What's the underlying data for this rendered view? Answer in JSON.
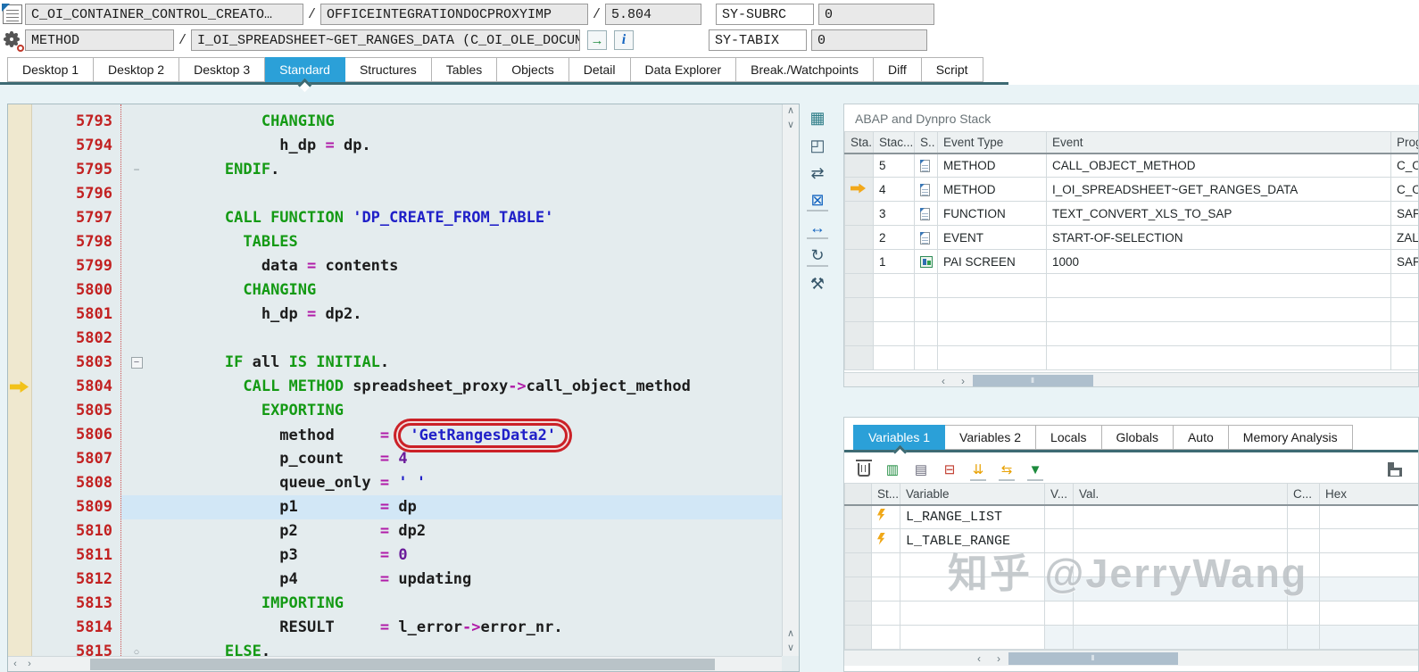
{
  "header": {
    "row1": {
      "source_icon": "abap-source-icon",
      "class_field": "C_OI_CONTAINER_CONTROL_CREATO…",
      "sep1": "/",
      "program_field": "OFFICEINTEGRATIONDOCPROXYIMP",
      "sep2": "/",
      "line_field": "5.804",
      "sysvar_label": "SY-SUBRC",
      "sysvar_value": "0"
    },
    "row2": {
      "method_icon": "method-gear-icon",
      "kind_field": "METHOD",
      "sep1": "/",
      "method_field": "I_OI_SPREADSHEET~GET_RANGES_DATA (C_OI_OLE_DOCUMEN…",
      "buttons": [
        "goto-icon",
        "info-icon"
      ],
      "sysvar_label": "SY-TABIX",
      "sysvar_value": "0"
    }
  },
  "tabs": {
    "items": [
      "Desktop 1",
      "Desktop 2",
      "Desktop 3",
      "Standard",
      "Structures",
      "Tables",
      "Objects",
      "Detail",
      "Data Explorer",
      "Break./Watchpoints",
      "Diff",
      "Script"
    ],
    "active": "Standard"
  },
  "editor": {
    "current_line": 5804,
    "highlighted_line": 5809,
    "annotation": "red-oval-around-GetRangesData2",
    "lines": [
      {
        "num": 5793,
        "segs": [
          [
            "pl",
            "            "
          ],
          [
            "kw",
            "CHANGING"
          ]
        ]
      },
      {
        "num": 5794,
        "segs": [
          [
            "pl",
            "              h_dp "
          ],
          [
            "op",
            "="
          ],
          [
            "pl",
            " dp."
          ]
        ]
      },
      {
        "num": 5795,
        "fold": "dash",
        "segs": [
          [
            "pl",
            "        "
          ],
          [
            "kw",
            "ENDIF"
          ],
          [
            "pl",
            "."
          ]
        ]
      },
      {
        "num": 5796,
        "segs": []
      },
      {
        "num": 5797,
        "segs": [
          [
            "pl",
            "        "
          ],
          [
            "kw",
            "CALL FUNCTION"
          ],
          [
            "pl",
            " "
          ],
          [
            "str",
            "'DP_CREATE_FROM_TABLE'"
          ]
        ]
      },
      {
        "num": 5798,
        "segs": [
          [
            "pl",
            "          "
          ],
          [
            "kw",
            "TABLES"
          ]
        ]
      },
      {
        "num": 5799,
        "segs": [
          [
            "pl",
            "            data "
          ],
          [
            "op",
            "="
          ],
          [
            "pl",
            " contents"
          ]
        ]
      },
      {
        "num": 5800,
        "segs": [
          [
            "pl",
            "          "
          ],
          [
            "kw",
            "CHANGING"
          ]
        ]
      },
      {
        "num": 5801,
        "segs": [
          [
            "pl",
            "            h_dp "
          ],
          [
            "op",
            "="
          ],
          [
            "pl",
            " dp2."
          ]
        ]
      },
      {
        "num": 5802,
        "segs": []
      },
      {
        "num": 5803,
        "fold": "minus",
        "segs": [
          [
            "pl",
            "        "
          ],
          [
            "kw",
            "IF"
          ],
          [
            "pl",
            " all "
          ],
          [
            "kw",
            "IS INITIAL"
          ],
          [
            "pl",
            "."
          ]
        ]
      },
      {
        "num": 5804,
        "arrow": true,
        "segs": [
          [
            "pl",
            "          "
          ],
          [
            "kw",
            "CALL METHOD"
          ],
          [
            "pl",
            " spreadsheet_proxy"
          ],
          [
            "op",
            "->"
          ],
          [
            "pl",
            "call_object_method"
          ]
        ]
      },
      {
        "num": 5805,
        "segs": [
          [
            "pl",
            "            "
          ],
          [
            "kw",
            "EXPORTING"
          ]
        ]
      },
      {
        "num": 5806,
        "segs": [
          [
            "pl",
            "              method     "
          ],
          [
            "op",
            "="
          ],
          [
            "pl",
            " "
          ],
          [
            "annot",
            "'GetRangesData2'"
          ]
        ]
      },
      {
        "num": 5807,
        "segs": [
          [
            "pl",
            "              p_count    "
          ],
          [
            "op",
            "="
          ],
          [
            "pl",
            " "
          ],
          [
            "num",
            "4"
          ]
        ]
      },
      {
        "num": 5808,
        "segs": [
          [
            "pl",
            "              queue_only "
          ],
          [
            "op",
            "="
          ],
          [
            "pl",
            " "
          ],
          [
            "str",
            "' '"
          ]
        ]
      },
      {
        "num": 5809,
        "hl": true,
        "segs": [
          [
            "pl",
            "              p1         "
          ],
          [
            "op",
            "="
          ],
          [
            "pl",
            " dp"
          ]
        ]
      },
      {
        "num": 5810,
        "segs": [
          [
            "pl",
            "              p2         "
          ],
          [
            "op",
            "="
          ],
          [
            "pl",
            " dp2"
          ]
        ]
      },
      {
        "num": 5811,
        "segs": [
          [
            "pl",
            "              p3         "
          ],
          [
            "op",
            "="
          ],
          [
            "pl",
            " "
          ],
          [
            "num",
            "0"
          ]
        ]
      },
      {
        "num": 5812,
        "segs": [
          [
            "pl",
            "              p4         "
          ],
          [
            "op",
            "="
          ],
          [
            "pl",
            " updating"
          ]
        ]
      },
      {
        "num": 5813,
        "segs": [
          [
            "pl",
            "            "
          ],
          [
            "kw",
            "IMPORTING"
          ]
        ]
      },
      {
        "num": 5814,
        "segs": [
          [
            "pl",
            "              RESULT     "
          ],
          [
            "op",
            "="
          ],
          [
            "pl",
            " l_error"
          ],
          [
            "op",
            "->"
          ],
          [
            "pl",
            "error_nr."
          ]
        ]
      },
      {
        "num": 5815,
        "fold": "circle",
        "segs": [
          [
            "pl",
            "        "
          ],
          [
            "kw",
            "ELSE"
          ],
          [
            "pl",
            "."
          ]
        ]
      }
    ]
  },
  "side_toolbar": {
    "icons": [
      {
        "name": "session-grid-icon",
        "glyph": "▦",
        "tone": "teal"
      },
      {
        "name": "new-session-icon",
        "glyph": "◰",
        "tone": ""
      },
      {
        "name": "swap-views-icon",
        "glyph": "⇄",
        "tone": ""
      },
      {
        "name": "close-table-icon",
        "glyph": "⊠",
        "tone": "blue"
      },
      {
        "name": "column-width-icon",
        "glyph": "↔",
        "tone": "blue"
      },
      {
        "name": "refresh-icon",
        "glyph": "↻",
        "tone": ""
      },
      {
        "name": "tools-icon",
        "glyph": "⚒",
        "tone": ""
      }
    ]
  },
  "stack_panel": {
    "title": "ABAP and Dynpro Stack",
    "columns": [
      "Sta...",
      "Stac...",
      "S..",
      "Event Type",
      "Event",
      "Program"
    ],
    "rows": [
      {
        "arrow": false,
        "num": "5",
        "icon": "doc-icon",
        "type": "METHOD",
        "event": "CALL_OBJECT_METHOD",
        "program": "C_OI_A"
      },
      {
        "arrow": true,
        "num": "4",
        "icon": "doc-icon",
        "type": "METHOD",
        "event": "I_OI_SPREADSHEET~GET_RANGES_DATA",
        "program": "C_OI_C"
      },
      {
        "arrow": false,
        "num": "3",
        "icon": "doc-icon",
        "type": "FUNCTION",
        "event": "TEXT_CONVERT_XLS_TO_SAP",
        "program": "SAPLTR"
      },
      {
        "arrow": false,
        "num": "2",
        "icon": "doc-icon",
        "type": "EVENT",
        "event": "START-OF-SELECTION",
        "program": "ZALV_JE"
      },
      {
        "arrow": false,
        "num": "1",
        "icon": "screen-icon",
        "type": "PAI SCREEN",
        "event": "1000",
        "program": "SAPMSS"
      }
    ],
    "empty_rows": 4,
    "scrollbar": {
      "left_btn": "‹",
      "right_btn": "›"
    }
  },
  "variables_panel": {
    "tabs": [
      "Variables 1",
      "Variables 2",
      "Locals",
      "Globals",
      "Auto",
      "Memory Analysis"
    ],
    "active": "Variables 1",
    "toolbar": [
      {
        "name": "delete-icon",
        "glyph": "",
        "cls": "vi-trash"
      },
      {
        "name": "create-variable-icon",
        "glyph": "▥",
        "tone": "g-green"
      },
      {
        "name": "select-variables-icon",
        "glyph": "▤",
        "tone": "g-gray"
      },
      {
        "name": "delete-row-icon",
        "glyph": "⊟",
        "tone": "g-red"
      },
      {
        "name": "sort-icon",
        "glyph": "⇊",
        "tone": "g-amber",
        "u": true
      },
      {
        "name": "split-icon",
        "glyph": "⇆",
        "tone": "g-amber",
        "u": true
      },
      {
        "name": "services-icon",
        "glyph": "▼",
        "tone": "g-green",
        "u": true
      }
    ],
    "save_icon": "save-icon",
    "columns": [
      "St...",
      "Variable",
      "V...",
      "Val.",
      "C...",
      "Hex"
    ],
    "rows": [
      {
        "icon": "lightning-icon",
        "name": "L_RANGE_LIST"
      },
      {
        "icon": "lightning-icon",
        "name": "L_TABLE_RANGE"
      }
    ],
    "empty_rows": 4,
    "scrollbar": {
      "left_btn": "‹",
      "right_btn": "›"
    }
  },
  "watermark": "知乎 @JerryWang",
  "colors": {
    "accent_blue": "#2ba0d8",
    "tab_underline_teal": "#3d6a73",
    "editor_bg": "#e4ecee",
    "line_highlight": "#d2e7f6",
    "line_number_red": "#c22121",
    "keyword_green": "#149a14",
    "string_blue": "#2020c8",
    "operator_magenta": "#b01ba8",
    "number_purple": "#6a1b9a",
    "breakpoint_margin_beige": "#efe8cf",
    "current_line_arrow_yellow": "#f2c21a",
    "annotation_red": "#cb2127"
  }
}
